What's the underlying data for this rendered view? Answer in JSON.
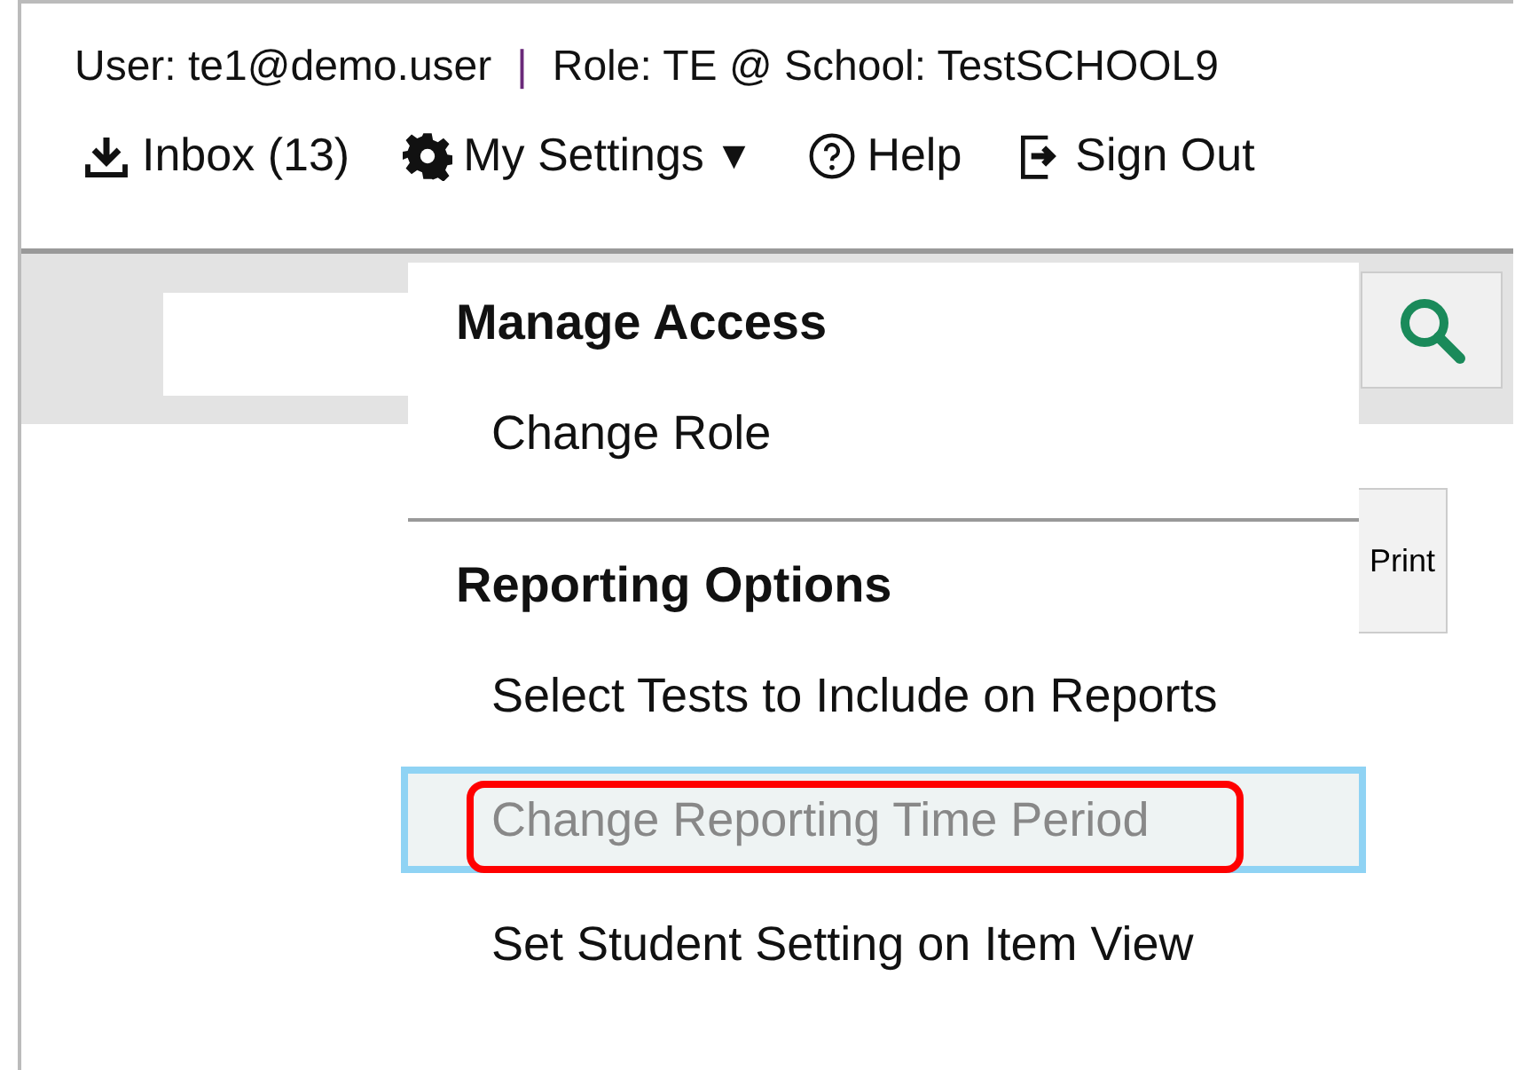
{
  "header": {
    "user": "User: te1@demo.user",
    "separator": "|",
    "role": "Role: TE @ School: TestSCHOOL9"
  },
  "nav": [
    {
      "kind": "inbox",
      "label": "Inbox (13)"
    },
    {
      "kind": "settings",
      "label": "My Settings",
      "caret": "▼"
    },
    {
      "kind": "help",
      "label": "Help"
    },
    {
      "kind": "signout",
      "label": "Sign Out"
    }
  ],
  "toolbar": {
    "print_label": "Print"
  },
  "menu": {
    "sections": [
      {
        "title": "Manage Access",
        "items": [
          {
            "label": "Change Role",
            "selected": false
          }
        ]
      },
      {
        "title": "Reporting Options",
        "items": [
          {
            "label": "Select Tests to Include on Reports",
            "selected": false
          },
          {
            "label": "Change Reporting Time Period",
            "selected": true
          },
          {
            "label": "Set Student Setting on Item View",
            "selected": false
          }
        ]
      }
    ]
  }
}
